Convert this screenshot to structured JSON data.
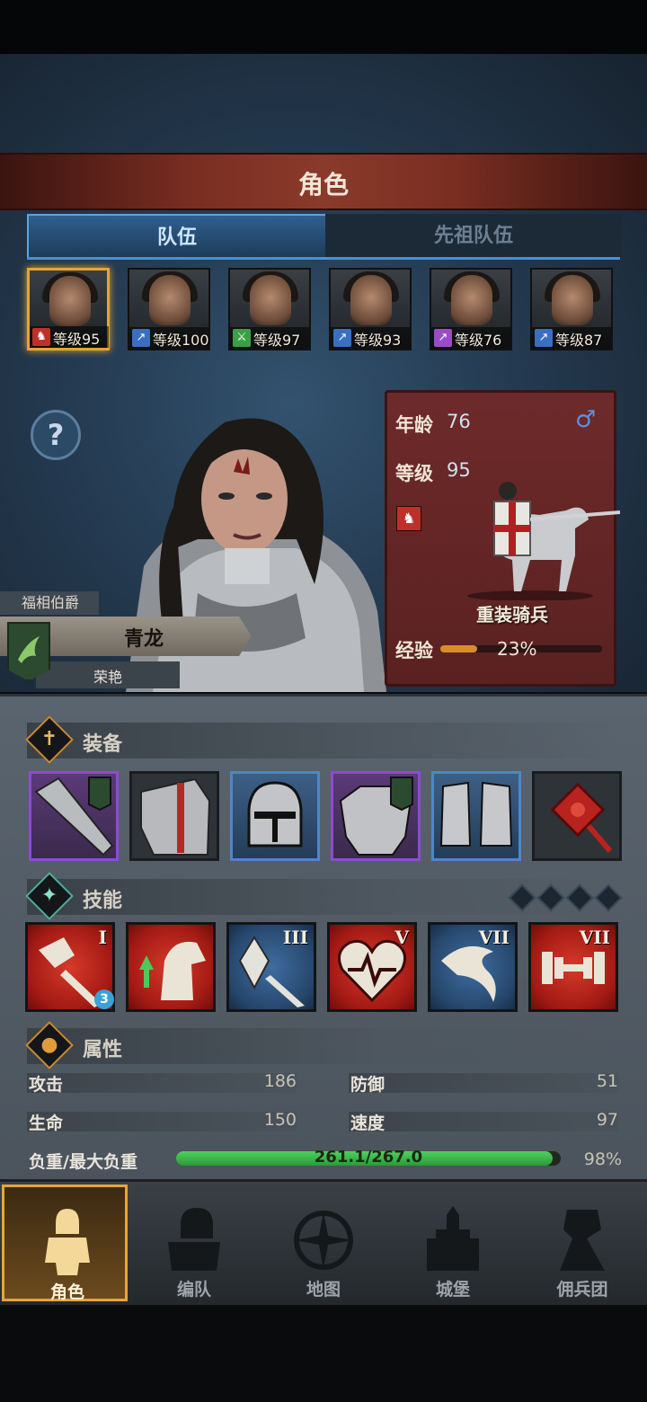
{
  "screen_title": "角色",
  "tabs": [
    {
      "label": "队伍",
      "active": true
    },
    {
      "label": "先祖队伍",
      "active": false
    }
  ],
  "heroes": [
    {
      "level_text": "等级95",
      "class_color": "#c0302a",
      "selected": true
    },
    {
      "level_text": "等级100",
      "class_color": "#3a6fc0",
      "selected": false
    },
    {
      "level_text": "等级97",
      "class_color": "#3aa046",
      "selected": false
    },
    {
      "level_text": "等级93",
      "class_color": "#3a6fc0",
      "selected": false
    },
    {
      "level_text": "等级76",
      "class_color": "#9a4cc8",
      "selected": false
    },
    {
      "level_text": "等级87",
      "class_color": "#3a6fc0",
      "selected": false
    }
  ],
  "character": {
    "noble_title": "福相伯爵",
    "name": "青龙",
    "subtitle": "荣艳",
    "age_label": "年龄",
    "age": "76",
    "level_label": "等级",
    "level": "95",
    "gender_icon": "♂",
    "unit_type": "重装骑兵",
    "exp_label": "经验",
    "exp_percent_text": "23%",
    "exp_fraction": 0.23
  },
  "sections": {
    "equipment": "装备",
    "skills": "技能",
    "attributes": "属性"
  },
  "equipment": [
    {
      "icon": "lance-icon",
      "rarity": "purple"
    },
    {
      "icon": "shield-icon",
      "rarity": "none"
    },
    {
      "icon": "helmet-icon",
      "rarity": "blue"
    },
    {
      "icon": "armor-icon",
      "rarity": "purple"
    },
    {
      "icon": "boots-icon",
      "rarity": "blue"
    },
    {
      "icon": "chinese-knot-icon",
      "rarity": "none"
    }
  ],
  "skills": [
    {
      "icon": "broken-sword-icon",
      "rank": "I",
      "color": "red",
      "badge": "3"
    },
    {
      "icon": "horse-boost-icon",
      "rank": "",
      "color": "red",
      "badge": ""
    },
    {
      "icon": "crystal-sword-icon",
      "rank": "III",
      "color": "blue",
      "badge": ""
    },
    {
      "icon": "heart-beat-icon",
      "rank": "V",
      "color": "red",
      "badge": ""
    },
    {
      "icon": "swoosh-icon",
      "rank": "VII",
      "color": "blue",
      "badge": ""
    },
    {
      "icon": "dumbbell-icon",
      "rank": "VII",
      "color": "red",
      "badge": ""
    }
  ],
  "attributes": {
    "attack_label": "攻击",
    "attack": "186",
    "defense_label": "防御",
    "defense": "51",
    "hp_label": "生命",
    "hp": "150",
    "speed_label": "速度",
    "speed": "97",
    "load_label": "负重/最大负重",
    "load_text": "261.1/267.0",
    "load_percent_text": "98%",
    "load_fraction": 0.98
  },
  "nav": [
    {
      "label": "角色",
      "icon": "knight-icon",
      "active": true
    },
    {
      "label": "编队",
      "icon": "formation-icon",
      "active": false
    },
    {
      "label": "地图",
      "icon": "compass-icon",
      "active": false
    },
    {
      "label": "城堡",
      "icon": "castle-icon",
      "active": false
    },
    {
      "label": "佣兵团",
      "icon": "mercenary-icon",
      "active": false
    }
  ]
}
